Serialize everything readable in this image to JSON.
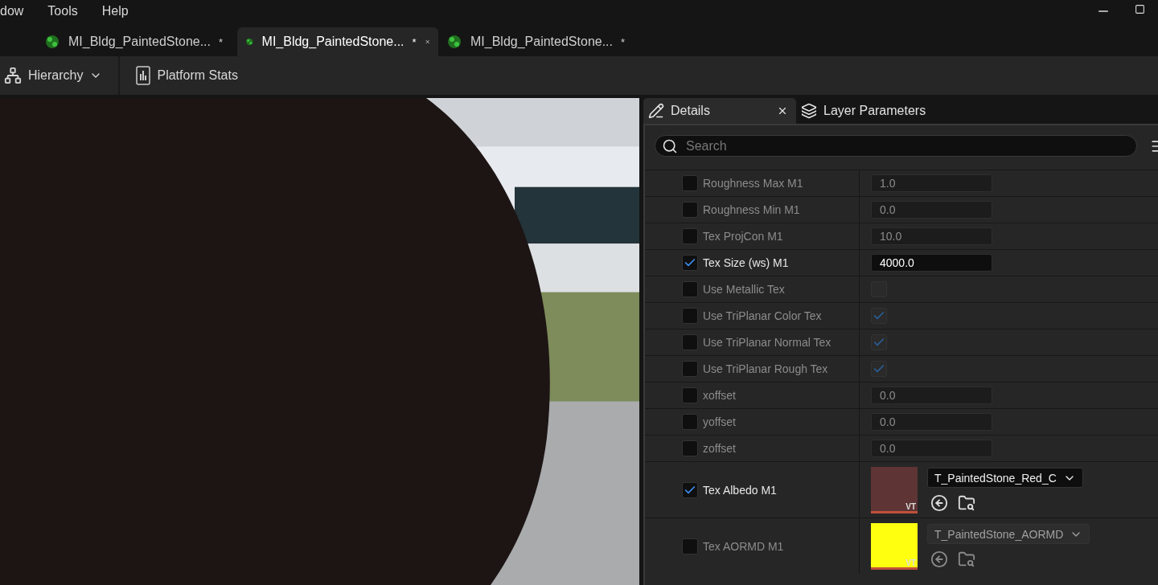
{
  "menu": [
    "dow",
    "Tools",
    "Help"
  ],
  "document_tabs": [
    {
      "label": "MI_Bldg_PaintedStone...",
      "modified": "*",
      "selected": false
    },
    {
      "label": "MI_Bldg_PaintedStone...",
      "modified": "*",
      "selected": true
    },
    {
      "label": "MI_Bldg_PaintedStone...",
      "modified": "*",
      "selected": false
    }
  ],
  "toolbar": [
    {
      "label": "Hierarchy",
      "kind": "dropdown"
    },
    {
      "label": "Platform Stats",
      "kind": "button"
    }
  ],
  "details_tabs": [
    {
      "label": "Details",
      "selected": true
    },
    {
      "label": "Layer Parameters",
      "selected": false
    }
  ],
  "search": {
    "placeholder": "Search"
  },
  "params": [
    {
      "kind": "number",
      "label": "Roughness Max M1",
      "override": false,
      "value": "1.0"
    },
    {
      "kind": "number",
      "label": "Roughness Min M1",
      "override": false,
      "value": "0.0"
    },
    {
      "kind": "number",
      "label": "Tex ProjCon M1",
      "override": false,
      "value": "10.0"
    },
    {
      "kind": "number",
      "label": "Tex Size (ws) M1",
      "override": true,
      "value": "4000.0"
    },
    {
      "kind": "bool",
      "label": "Use Metallic Tex",
      "override": false,
      "checked": false
    },
    {
      "kind": "bool",
      "label": "Use TriPlanar Color Tex",
      "override": false,
      "checked": true
    },
    {
      "kind": "bool",
      "label": "Use TriPlanar Normal Tex",
      "override": false,
      "checked": true
    },
    {
      "kind": "bool",
      "label": "Use TriPlanar Rough Tex",
      "override": false,
      "checked": true
    },
    {
      "kind": "number",
      "label": "xoffset",
      "override": false,
      "value": "0.0"
    },
    {
      "kind": "number",
      "label": "yoffset",
      "override": false,
      "value": "0.0"
    },
    {
      "kind": "number",
      "label": "zoffset",
      "override": false,
      "value": "0.0"
    },
    {
      "kind": "texture",
      "label": "Tex Albedo M1",
      "override": true,
      "texture": "T_PaintedStone_Red_C",
      "badge": "VT",
      "color": "#5e3434"
    },
    {
      "kind": "texture",
      "label": "Tex AORMD M1",
      "override": false,
      "texture": "T_PaintedStone_AORMD",
      "badge": "VT",
      "color": "#ffff10"
    }
  ]
}
